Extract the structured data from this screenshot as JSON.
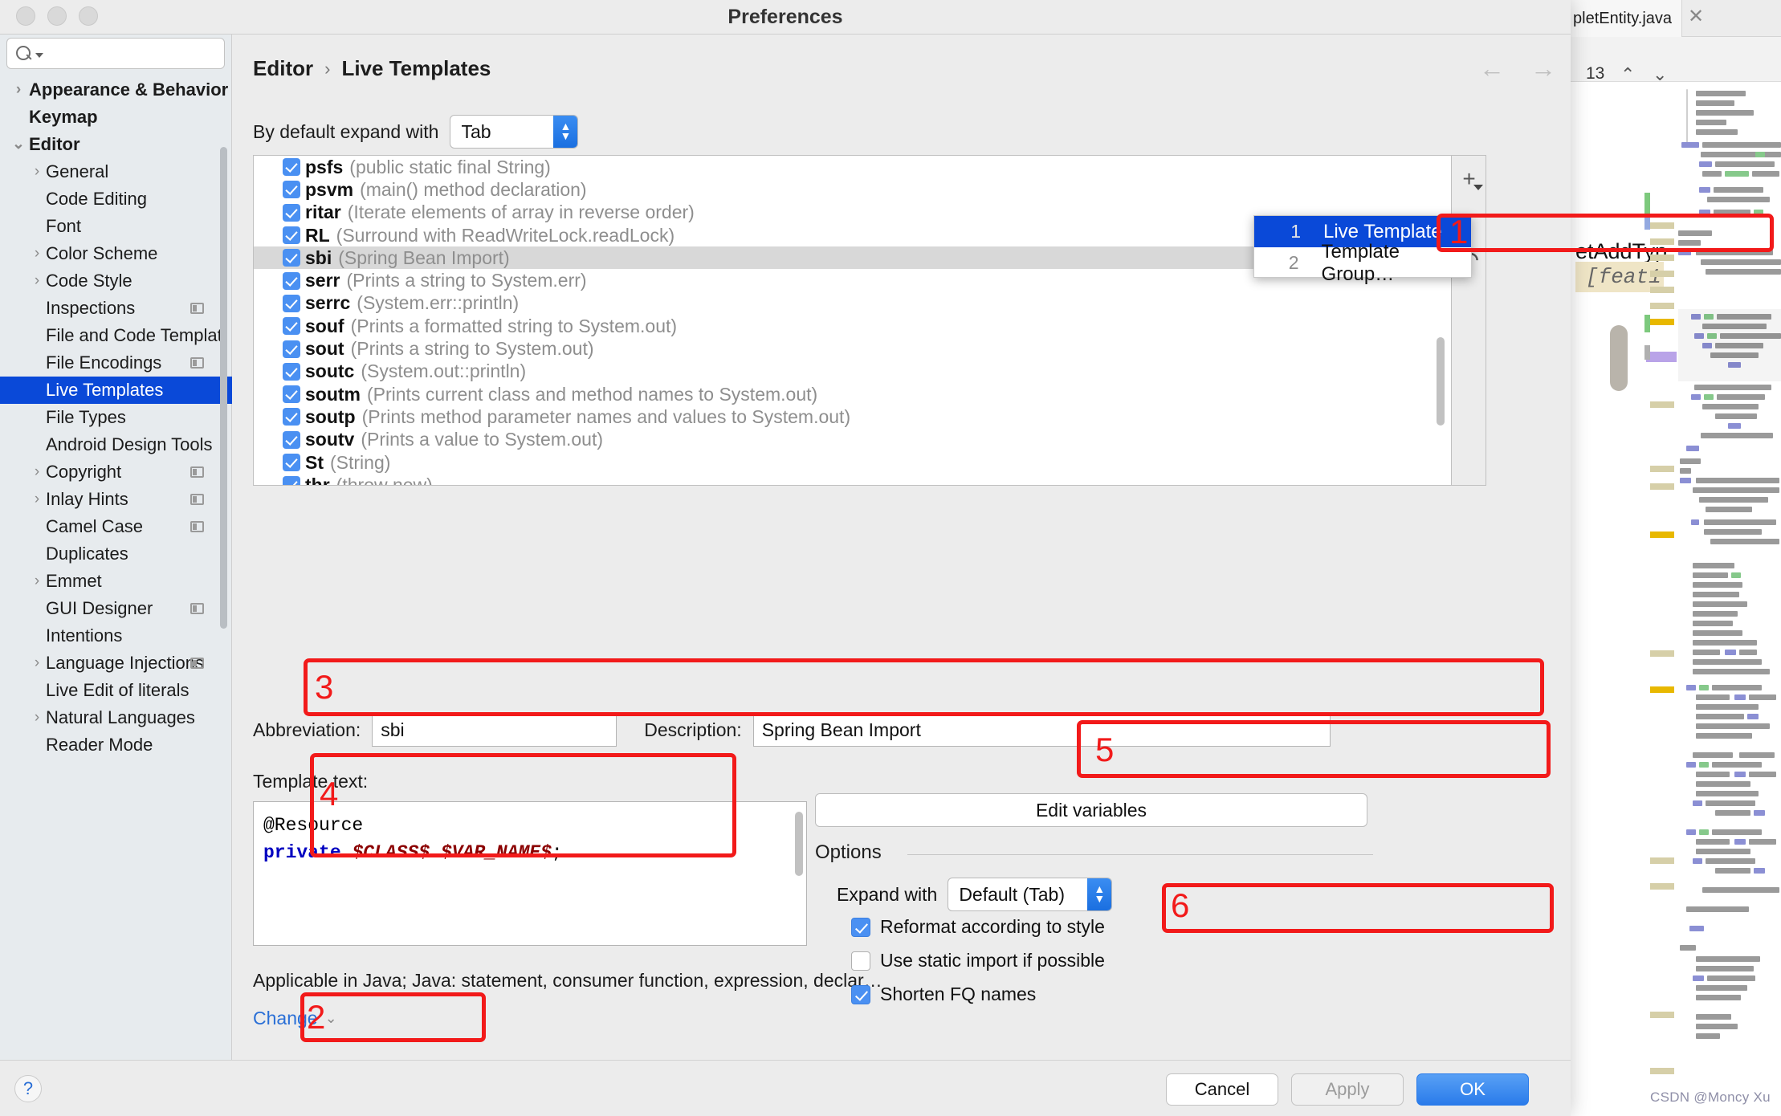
{
  "window": {
    "title": "Preferences"
  },
  "sidebar": {
    "search_placeholder": "",
    "items": [
      {
        "label": "Appearance & Behavior",
        "level": 0,
        "chevron": "›",
        "badge": false,
        "selected": false
      },
      {
        "label": "Keymap",
        "level": 0,
        "chevron": "",
        "badge": false,
        "selected": false
      },
      {
        "label": "Editor",
        "level": 0,
        "chevron": "⌄",
        "badge": false,
        "selected": false
      },
      {
        "label": "General",
        "level": 1,
        "chevron": "›",
        "badge": false,
        "selected": false
      },
      {
        "label": "Code Editing",
        "level": 1,
        "chevron": "",
        "badge": false,
        "selected": false
      },
      {
        "label": "Font",
        "level": 1,
        "chevron": "",
        "badge": false,
        "selected": false
      },
      {
        "label": "Color Scheme",
        "level": 1,
        "chevron": "›",
        "badge": false,
        "selected": false
      },
      {
        "label": "Code Style",
        "level": 1,
        "chevron": "›",
        "badge": false,
        "selected": false
      },
      {
        "label": "Inspections",
        "level": 1,
        "chevron": "",
        "badge": true,
        "selected": false
      },
      {
        "label": "File and Code Templat",
        "level": 1,
        "chevron": "",
        "badge": false,
        "selected": false
      },
      {
        "label": "File Encodings",
        "level": 1,
        "chevron": "",
        "badge": true,
        "selected": false
      },
      {
        "label": "Live Templates",
        "level": 1,
        "chevron": "",
        "badge": false,
        "selected": true
      },
      {
        "label": "File Types",
        "level": 1,
        "chevron": "",
        "badge": false,
        "selected": false
      },
      {
        "label": "Android Design Tools",
        "level": 1,
        "chevron": "",
        "badge": false,
        "selected": false
      },
      {
        "label": "Copyright",
        "level": 1,
        "chevron": "›",
        "badge": true,
        "selected": false
      },
      {
        "label": "Inlay Hints",
        "level": 1,
        "chevron": "›",
        "badge": true,
        "selected": false
      },
      {
        "label": "Camel Case",
        "level": 1,
        "chevron": "",
        "badge": true,
        "selected": false
      },
      {
        "label": "Duplicates",
        "level": 1,
        "chevron": "",
        "badge": false,
        "selected": false
      },
      {
        "label": "Emmet",
        "level": 1,
        "chevron": "›",
        "badge": false,
        "selected": false
      },
      {
        "label": "GUI Designer",
        "level": 1,
        "chevron": "",
        "badge": true,
        "selected": false
      },
      {
        "label": "Intentions",
        "level": 1,
        "chevron": "",
        "badge": false,
        "selected": false
      },
      {
        "label": "Language Injections",
        "level": 1,
        "chevron": "›",
        "badge": true,
        "selected": false
      },
      {
        "label": "Live Edit of literals",
        "level": 1,
        "chevron": "",
        "badge": false,
        "selected": false
      },
      {
        "label": "Natural Languages",
        "level": 1,
        "chevron": "›",
        "badge": false,
        "selected": false
      },
      {
        "label": "Reader Mode",
        "level": 1,
        "chevron": "",
        "badge": false,
        "selected": false
      }
    ]
  },
  "header": {
    "breadcrumb_root": "Editor",
    "breadcrumb_sep": "›",
    "breadcrumb_leaf": "Live Templates",
    "back_arrow": "←",
    "forward_arrow": "→"
  },
  "expand_default": {
    "label": "By default expand with",
    "value": "Tab"
  },
  "templates": [
    {
      "abbr": "psfs",
      "desc": "(public static final String)",
      "checked": true,
      "selected": false
    },
    {
      "abbr": "psvm",
      "desc": "(main() method declaration)",
      "checked": true,
      "selected": false
    },
    {
      "abbr": "ritar",
      "desc": "(Iterate elements of array in reverse order)",
      "checked": true,
      "selected": false
    },
    {
      "abbr": "RL",
      "desc": "(Surround with ReadWriteLock.readLock)",
      "checked": true,
      "selected": false
    },
    {
      "abbr": "sbi",
      "desc": "(Spring Bean Import)",
      "checked": true,
      "selected": true
    },
    {
      "abbr": "serr",
      "desc": "(Prints a string to System.err)",
      "checked": true,
      "selected": false
    },
    {
      "abbr": "serrc",
      "desc": "(System.err::println)",
      "checked": true,
      "selected": false
    },
    {
      "abbr": "souf",
      "desc": "(Prints a formatted string to System.out)",
      "checked": true,
      "selected": false
    },
    {
      "abbr": "sout",
      "desc": "(Prints a string to System.out)",
      "checked": true,
      "selected": false
    },
    {
      "abbr": "soutc",
      "desc": "(System.out::println)",
      "checked": true,
      "selected": false
    },
    {
      "abbr": "soutm",
      "desc": "(Prints current class and method names to System.out)",
      "checked": true,
      "selected": false
    },
    {
      "abbr": "soutp",
      "desc": "(Prints method parameter names and values to System.out)",
      "checked": true,
      "selected": false
    },
    {
      "abbr": "soutv",
      "desc": "(Prints a value to System.out)",
      "checked": true,
      "selected": false
    },
    {
      "abbr": "St",
      "desc": "(String)",
      "checked": true,
      "selected": false
    },
    {
      "abbr": "thr",
      "desc": "(throw new)",
      "checked": true,
      "selected": false
    }
  ],
  "list_toolbar": {
    "add_icon": "+",
    "undo_icon": "↶"
  },
  "popup_menu": {
    "items": [
      {
        "num": "1",
        "label": "Live Template",
        "highlighted": true
      },
      {
        "num": "2",
        "label": "Template Group…",
        "highlighted": false
      }
    ]
  },
  "fields": {
    "abbreviation_label": "Abbreviation:",
    "abbreviation_value": "sbi",
    "description_label": "Description:",
    "description_value": "Spring Bean Import",
    "template_text_label": "Template text:",
    "template_text_line1": "@Resource",
    "template_text_kw": "private",
    "template_text_var1": "$CLASS$",
    "template_text_var2": "$VAR_NAME$",
    "template_text_semi": ";",
    "applicable_text": "Applicable in Java; Java: statement, consumer function, expression, declar…",
    "change_label": "Change",
    "change_caret": "⌄"
  },
  "options": {
    "edit_variables_label": "Edit variables",
    "title": "Options",
    "expand_with_label": "Expand with",
    "expand_with_value": "Default (Tab)",
    "checkboxes": [
      {
        "label": "Reformat according to style",
        "checked": true
      },
      {
        "label": "Use static import if possible",
        "checked": false
      },
      {
        "label": "Shorten FQ names",
        "checked": true
      }
    ]
  },
  "footer": {
    "help": "?",
    "cancel": "Cancel",
    "apply": "Apply",
    "ok": "OK"
  },
  "annotations": [
    {
      "num": "1"
    },
    {
      "num": "2"
    },
    {
      "num": "3"
    },
    {
      "num": "4"
    },
    {
      "num": "5"
    },
    {
      "num": "6"
    }
  ],
  "background_editor": {
    "tab_name": "pletEntity.java",
    "tab_close": "✕",
    "find_count": "13",
    "find_prev": "⌃",
    "find_next": "⌄",
    "code_fragment": "etAddTyp",
    "code_inline_hint": "[feat1",
    "watermark": "CSDN @Moncy Xu"
  },
  "colors": {
    "accent_blue": "#0a49d8",
    "checkbox_blue": "#4a90f2",
    "annotation_red": "#f21a1a",
    "window_bg": "#ececec",
    "sidebar_bg": "#e7ebee"
  }
}
